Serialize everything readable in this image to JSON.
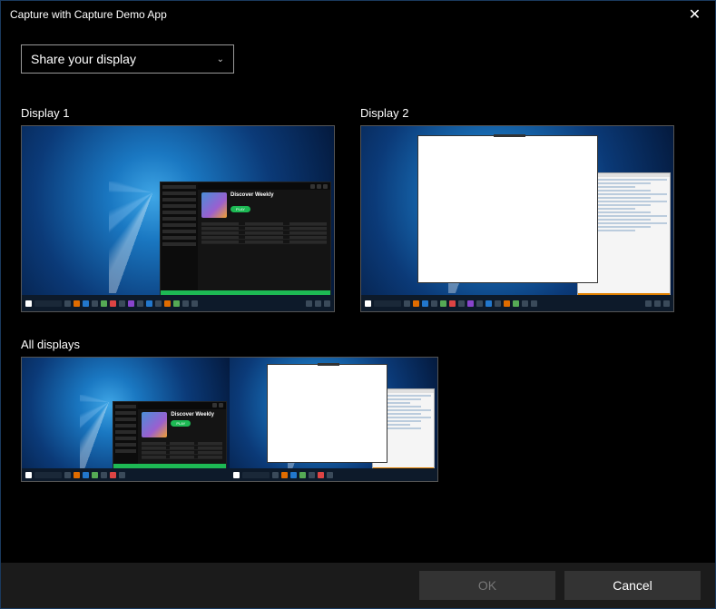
{
  "window": {
    "title": "Capture with Capture Demo App"
  },
  "dropdown": {
    "selected": "Share your display"
  },
  "options": {
    "display1_label": "Display 1",
    "display2_label": "Display 2",
    "all_label": "All displays"
  },
  "preview": {
    "spotify_title": "Discover Weekly",
    "spotify_play": "PLAY"
  },
  "footer": {
    "ok": "OK",
    "cancel": "Cancel"
  },
  "icons": {
    "close": "✕",
    "chevron_down": "⌄"
  }
}
